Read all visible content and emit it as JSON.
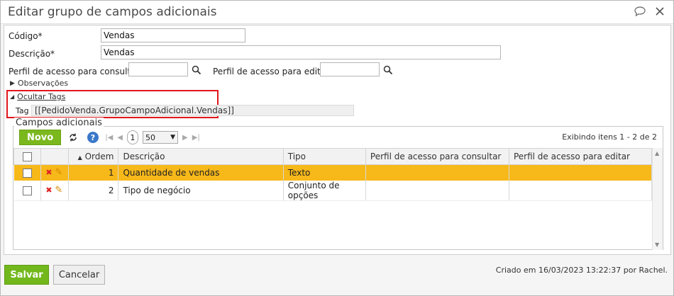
{
  "window": {
    "title": "Editar grupo de campos adicionais"
  },
  "form": {
    "codigo_label": "Código*",
    "codigo_value": "Vendas",
    "descricao_label": "Descrição*",
    "descricao_value": "Vendas",
    "perfil_consultar_label": "Perfil de acesso para consultar",
    "perfil_consultar_value": "",
    "perfil_editar_label": "Perfil de acesso para editar",
    "perfil_editar_value": "",
    "observacoes_label": "Observações",
    "ocultar_tags_label": "Ocultar Tags",
    "tag_label": "Tag",
    "tag_value": "[[PedidoVenda.GrupoCampoAdicional.Vendas]]"
  },
  "grid": {
    "legend": "Campos adicionais",
    "novo_label": "Novo",
    "page": "1",
    "page_size": "50",
    "info": "Exibindo itens 1 - 2 de 2",
    "columns": [
      "Ordem",
      "Descrição",
      "Tipo",
      "Perfil de acesso para consultar",
      "Perfil de acesso para editar"
    ],
    "rows": [
      {
        "ordem": "1",
        "descricao": "Quantidade de vendas",
        "tipo": "Texto",
        "perfil_consultar": "",
        "perfil_editar": ""
      },
      {
        "ordem": "2",
        "descricao": "Tipo de negócio",
        "tipo": "Conjunto de opções",
        "perfil_consultar": "",
        "perfil_editar": ""
      }
    ]
  },
  "footer": {
    "salvar_label": "Salvar",
    "cancelar_label": "Cancelar",
    "created_text": "Criado em 16/03/2023 13:22:37 por Rachel."
  },
  "colors": {
    "accent_green": "#7bb81e",
    "selected_row": "#f7b81a",
    "highlight_box": "#e0161b"
  }
}
